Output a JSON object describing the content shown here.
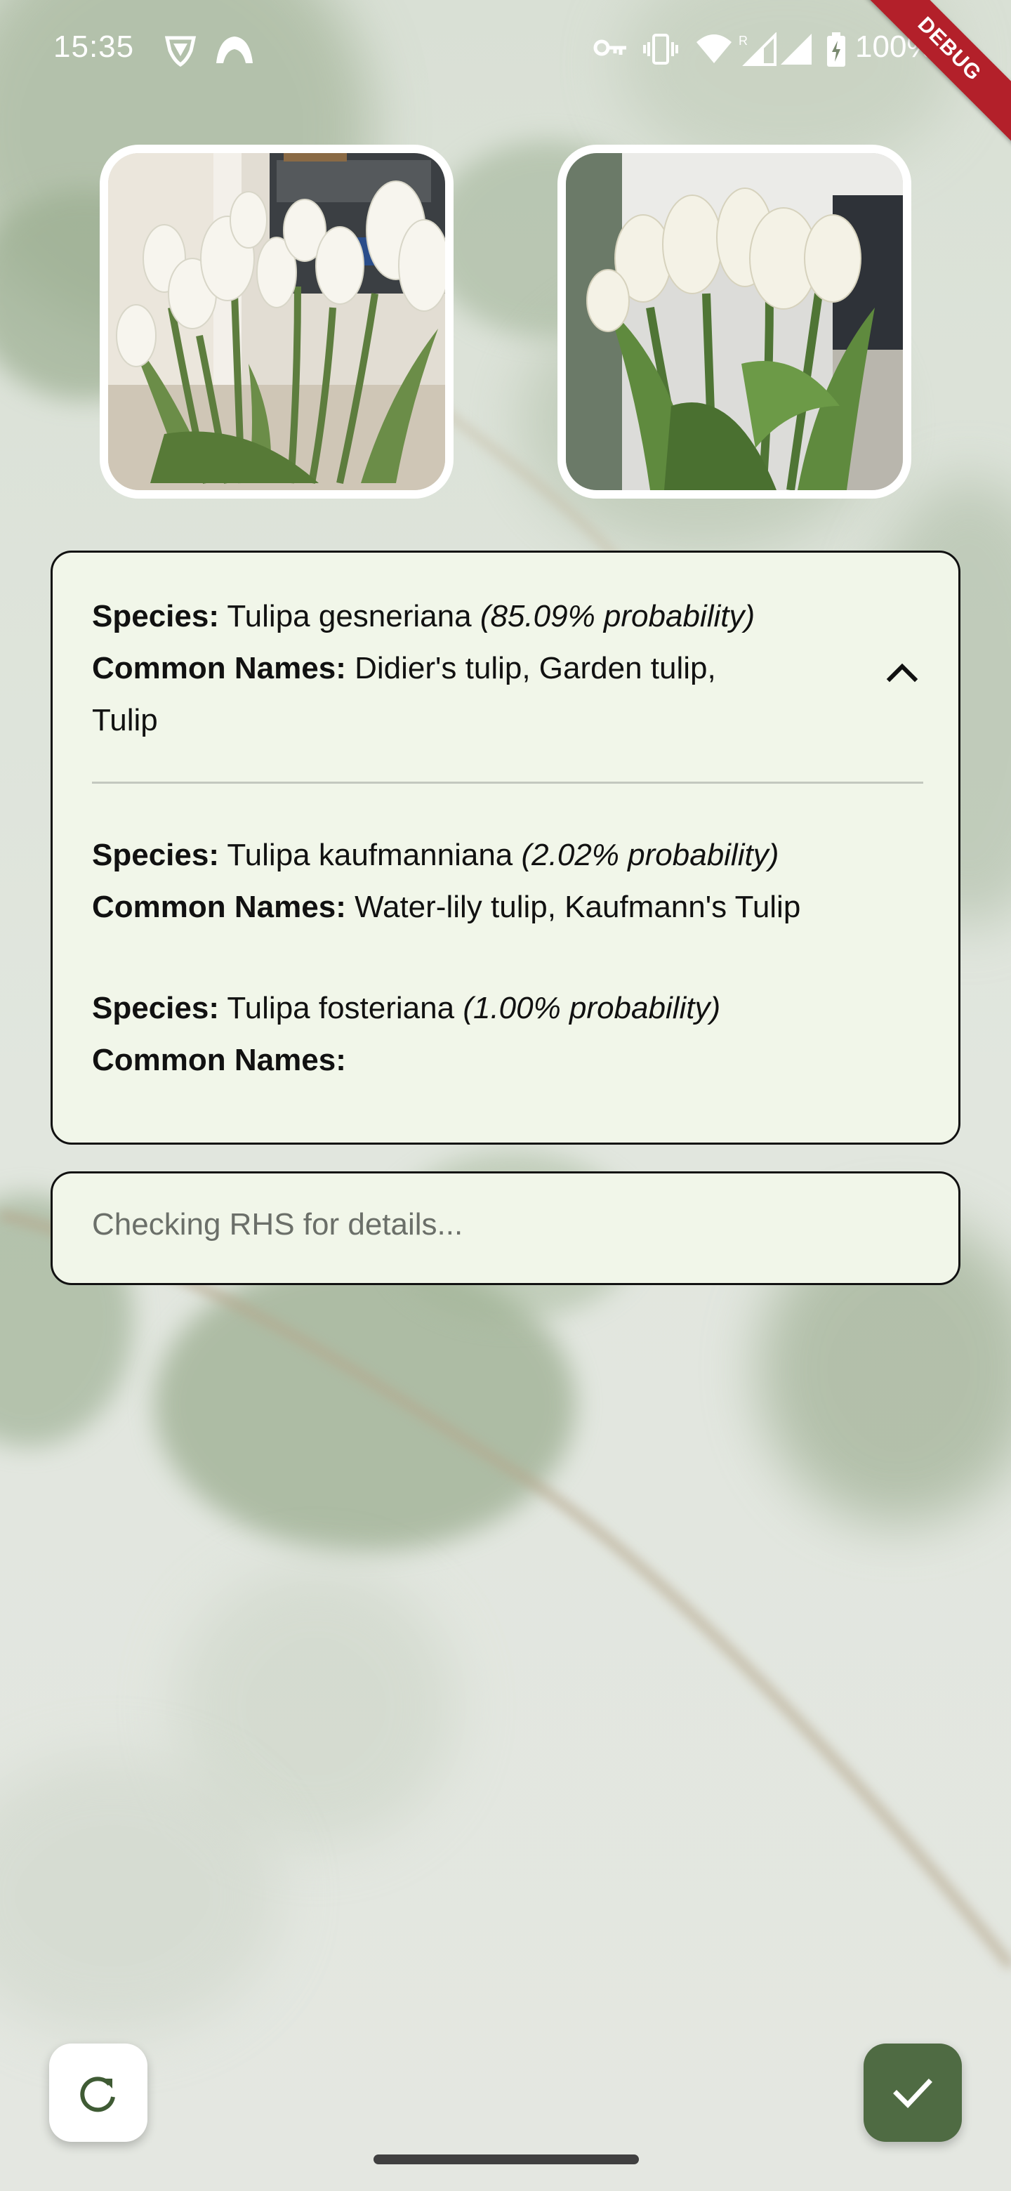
{
  "status_bar": {
    "time": "15:35",
    "battery": "100%",
    "icons": [
      "vpn-shield-icon",
      "cloud-arch-icon",
      "key-icon",
      "vibrate-icon",
      "wifi-icon",
      "signal-roaming-icon",
      "signal-icon",
      "battery-charging-icon"
    ],
    "debug_label": "DEBUG"
  },
  "photos": [
    {
      "name": "tulip-photo-1",
      "subject": "white tulips bouquet in front of shelf"
    },
    {
      "name": "tulip-photo-2",
      "subject": "white tulips close-up"
    }
  ],
  "results": [
    {
      "species_label": "Species:",
      "species": "Tulipa gesneriana",
      "probability": "(85.09% probability)",
      "common_label": "Common Names:",
      "common_line1": "Didier's tulip, Garden tulip,",
      "common_line2": "Tulip"
    },
    {
      "species_label": "Species:",
      "species": "Tulipa kaufmanniana",
      "probability": "(2.02% probability)",
      "common_label": "Common Names:",
      "common_names": "Water-lily tulip, Kaufmann's Tulip"
    },
    {
      "species_label": "Species:",
      "species": "Tulipa fosteriana",
      "probability": "(1.00% probability)",
      "common_label": "Common Names:",
      "common_names": ""
    }
  ],
  "collapse_icon": "chevron-up-icon",
  "rhs_status": "Checking RHS for details...",
  "fabs": {
    "refresh_icon": "refresh-icon",
    "confirm_icon": "check-icon"
  },
  "colors": {
    "card_background": "#f1f6e9",
    "card_border": "#111111",
    "confirm_button": "#4f6b43",
    "debug_banner": "#b3202a"
  }
}
